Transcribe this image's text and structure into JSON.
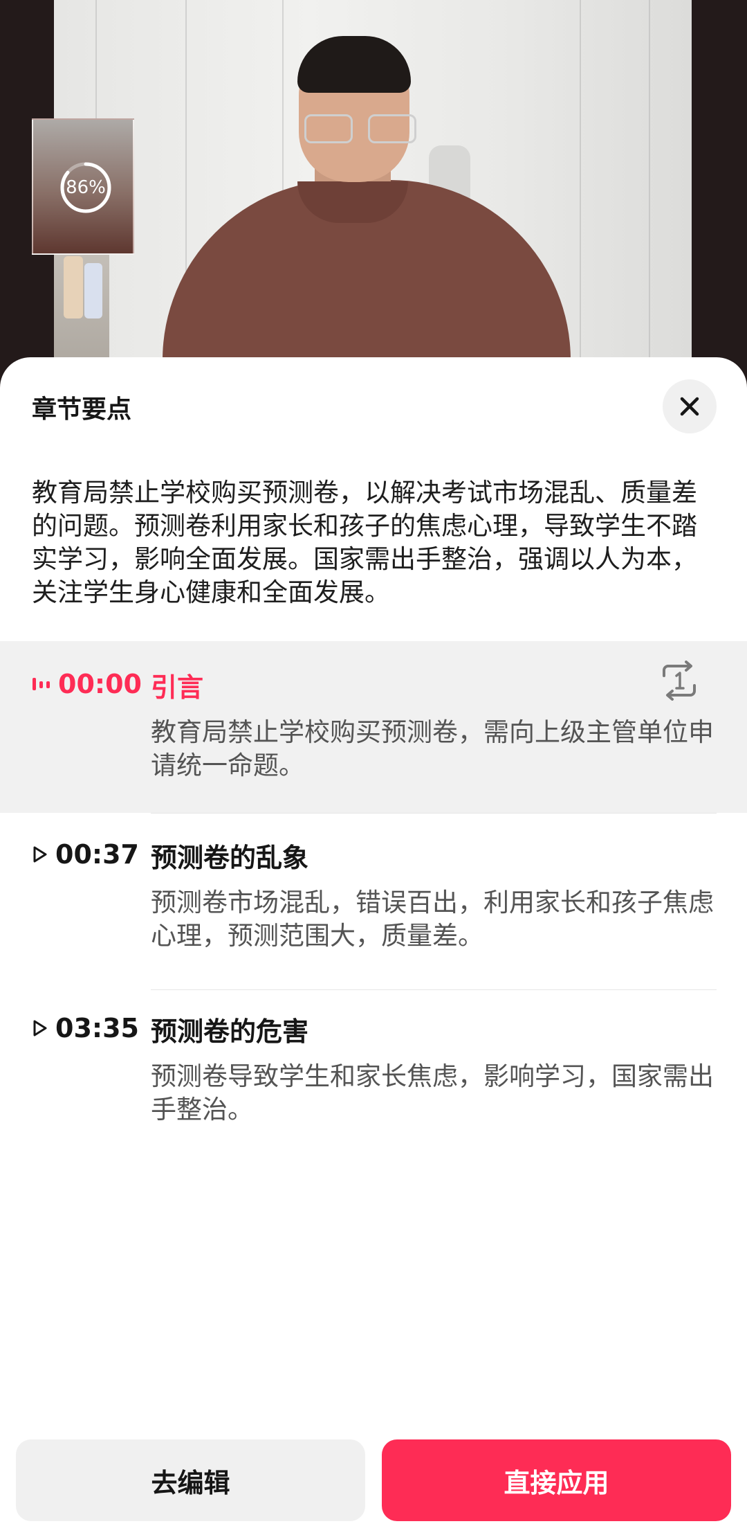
{
  "video": {
    "progress_text": "86%",
    "progress_fraction": 0.86
  },
  "sheet": {
    "title": "章节要点",
    "summary": "教育局禁止学校购买预测卷，以解决考试市场混乱、质量差的问题。预测卷利用家长和孩子的焦虑心理，导致学生不踏实学习，影响全面发展。国家需出手整治，强调以人为本，关注学生身心健康和全面发展。"
  },
  "chapters": [
    {
      "time": "00:00",
      "title": "引言",
      "desc": "教育局禁止学校购买预测卷，需向上级主管单位申请统一命题。",
      "active": true
    },
    {
      "time": "00:37",
      "title": "预测卷的乱象",
      "desc": "预测卷市场混乱，错误百出，利用家长和孩子焦虑心理，预测范围大，质量差。",
      "active": false
    },
    {
      "time": "03:35",
      "title": "预测卷的危害",
      "desc": "预测卷导致学生和家长焦虑，影响学习，国家需出手整治。",
      "active": false
    }
  ],
  "buttons": {
    "edit_label": "去编辑",
    "apply_label": "直接应用"
  },
  "colors": {
    "accent": "#fe2c55",
    "active_bg": "#f1f1f1"
  },
  "icons": {
    "close": "close-icon",
    "playing": "playing-bars-icon",
    "play": "play-triangle-icon",
    "loop": "loop-one-icon"
  }
}
